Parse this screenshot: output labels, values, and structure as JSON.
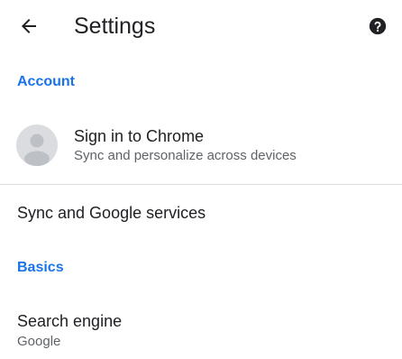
{
  "toolbar": {
    "title": "Settings",
    "back_icon": "arrow-back-icon",
    "help_icon": "help-circle-icon"
  },
  "sections": {
    "account": {
      "header": "Account",
      "signin": {
        "title": "Sign in to Chrome",
        "subtitle": "Sync and personalize across devices",
        "icon": "default-avatar-icon"
      },
      "sync": {
        "title": "Sync and Google services"
      }
    },
    "basics": {
      "header": "Basics",
      "search_engine": {
        "title": "Search engine",
        "value": "Google"
      }
    }
  },
  "colors": {
    "accent": "#1a73e8",
    "primary_text": "#202124",
    "secondary_text": "#5f6368",
    "divider": "#dadce0",
    "avatar_bg": "#dadce0",
    "avatar_fg": "#bdc1c6"
  }
}
